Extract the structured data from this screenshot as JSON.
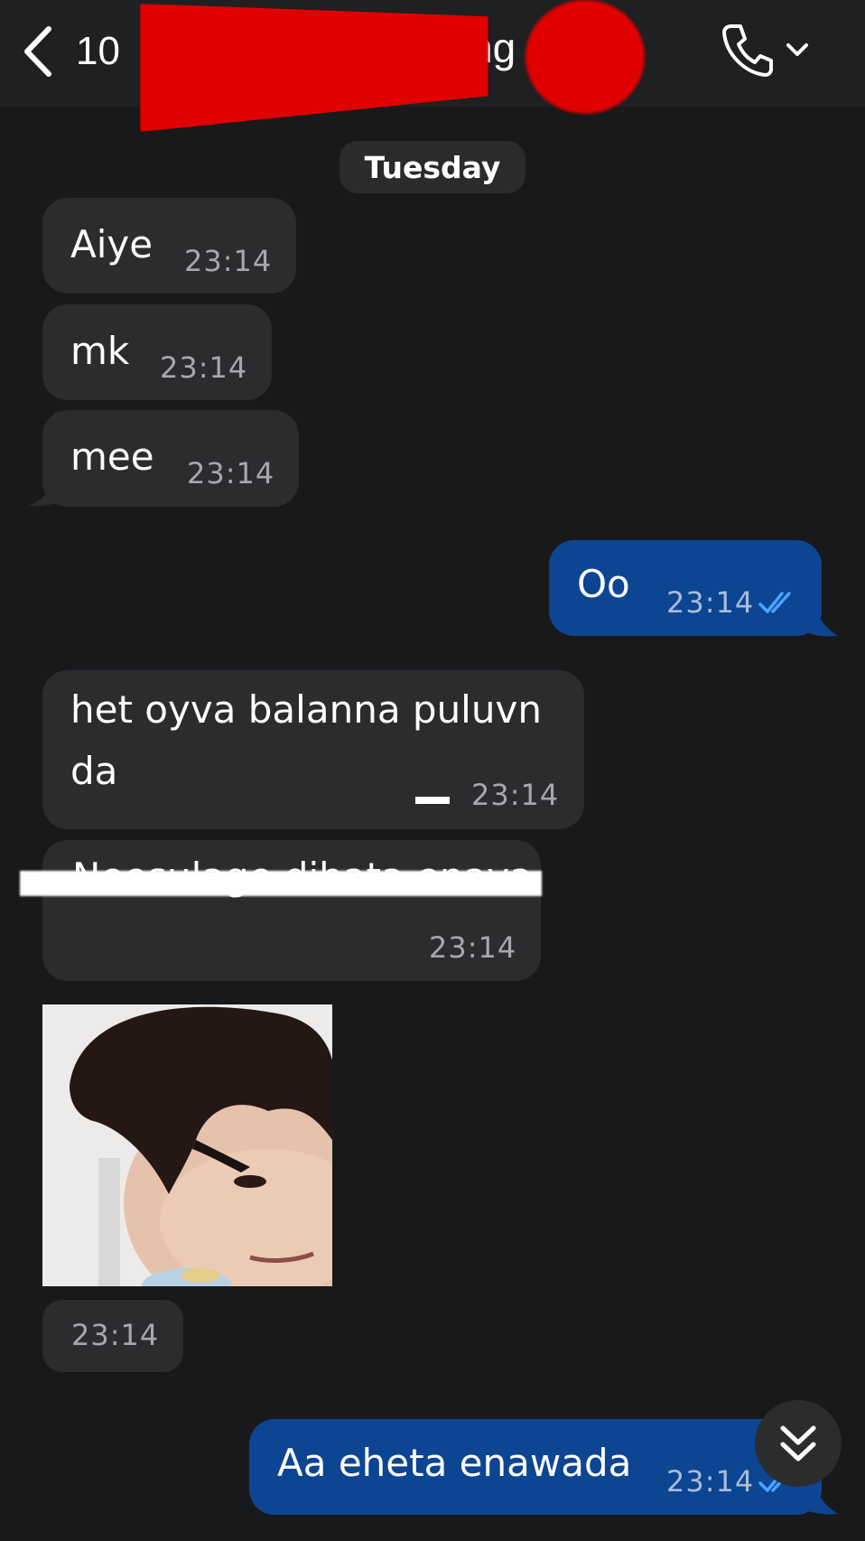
{
  "header": {
    "unread_count": "10",
    "contact_name_visible": "ng"
  },
  "date_separator": "Tuesday",
  "messages": [
    {
      "direction": "in",
      "text": "Aiye",
      "time": "23:14"
    },
    {
      "direction": "in",
      "text": "mk",
      "time": "23:14"
    },
    {
      "direction": "in",
      "text": "mee",
      "time": "23:14"
    },
    {
      "direction": "out",
      "text": "Oo",
      "time": "23:14",
      "status": "read"
    },
    {
      "direction": "in",
      "text_line1": "het oyva balanna puluvn",
      "text_line2": "da",
      "time": "23:14"
    },
    {
      "direction": "in",
      "text": "Neesulage dihata enava",
      "time": "23:14",
      "redacted": true
    },
    {
      "direction": "in",
      "type": "sticker",
      "time": "23:14"
    },
    {
      "direction": "out",
      "text": "Aa eheta enawada",
      "time": "23:14",
      "status": "read"
    }
  ],
  "colors": {
    "background": "#18191a",
    "incoming_bubble": "#2b2c2e",
    "outgoing_bubble": "#0c4592",
    "read_ticks": "#4aa3ff",
    "redaction": "#e00000"
  },
  "icons": {
    "back": "chevron-left-icon",
    "call": "phone-icon",
    "call_menu": "chevron-down-icon",
    "read_status": "double-check-icon",
    "scroll": "double-chevron-down-icon"
  }
}
